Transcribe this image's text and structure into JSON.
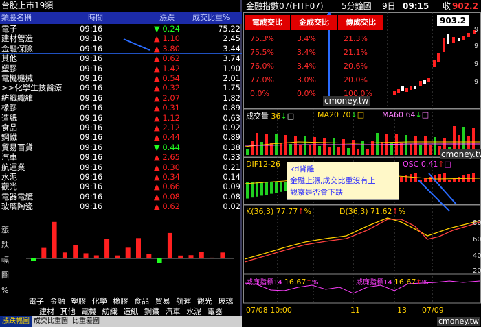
{
  "left_panel": {
    "title": "台股上市19類",
    "headers": [
      "類股名稱",
      "時間",
      "漲跌",
      "成交比重%"
    ],
    "rows": [
      {
        "name": "電子",
        "time": "09:16",
        "dir": "down",
        "chg": "0.24",
        "ratio": "75.22"
      },
      {
        "name": "建材營造",
        "time": "09:16",
        "dir": "up",
        "chg": "1.10",
        "ratio": "2.45"
      },
      {
        "name": "金融保險",
        "time": "09:16",
        "dir": "up",
        "chg": "3.80",
        "ratio": "3.44"
      },
      {
        "name": "其他",
        "time": "09:16",
        "dir": "up",
        "chg": "0.62",
        "ratio": "3.74"
      },
      {
        "name": "塑膠",
        "time": "09:16",
        "dir": "up",
        "chg": "1.42",
        "ratio": "1.90"
      },
      {
        "name": "電機機械",
        "time": "09:16",
        "dir": "up",
        "chg": "0.54",
        "ratio": "2.01"
      },
      {
        "name": ">>化學生技醫療",
        "time": "09:16",
        "dir": "up",
        "chg": "0.32",
        "ratio": "1.75"
      },
      {
        "name": "紡織纖維",
        "time": "09:16",
        "dir": "up",
        "chg": "2.07",
        "ratio": "1.82"
      },
      {
        "name": "橡膠",
        "time": "09:16",
        "dir": "up",
        "chg": "0.31",
        "ratio": "0.89"
      },
      {
        "name": "造紙",
        "time": "09:16",
        "dir": "up",
        "chg": "1.12",
        "ratio": "0.63"
      },
      {
        "name": "食品",
        "time": "09:16",
        "dir": "up",
        "chg": "2.12",
        "ratio": "0.92"
      },
      {
        "name": "鋼鐵",
        "time": "09:16",
        "dir": "up",
        "chg": "0.44",
        "ratio": "0.89"
      },
      {
        "name": "貿易百貨",
        "time": "09:16",
        "dir": "down",
        "chg": "0.44",
        "ratio": "0.38"
      },
      {
        "name": "汽車",
        "time": "09:16",
        "dir": "up",
        "chg": "2.65",
        "ratio": "0.33"
      },
      {
        "name": "航運業",
        "time": "09:16",
        "dir": "up",
        "chg": "0.30",
        "ratio": "0.21"
      },
      {
        "name": "水泥",
        "time": "09:16",
        "dir": "up",
        "chg": "0.34",
        "ratio": "0.14"
      },
      {
        "name": "觀光",
        "time": "09:16",
        "dir": "up",
        "chg": "0.66",
        "ratio": "0.09"
      },
      {
        "name": "電器電纜",
        "time": "09:16",
        "dir": "up",
        "chg": "0.08",
        "ratio": "0.08"
      },
      {
        "name": "玻璃陶瓷",
        "time": "09:16",
        "dir": "up",
        "chg": "0.62",
        "ratio": "0.02"
      }
    ],
    "bar_ylabel": "漲跌幅圖%",
    "bar_xlabels_row1": [
      "電子",
      "金融",
      "塑膠",
      "化學",
      "橡膠",
      "食品",
      "貿易",
      "航運",
      "觀光",
      "玻璃"
    ],
    "bar_xlabels_row2": [
      "建材",
      "其他",
      "電機",
      "紡織",
      "造紙",
      "鋼鐵",
      "汽車",
      "水泥",
      "電器"
    ],
    "tabs": [
      "漲跌幅圖",
      "成交比重圖",
      "比重差圖"
    ]
  },
  "right_panel": {
    "title": "金融指數07(FITF07)",
    "period": "5分鐘圖",
    "day": "9日",
    "time": "09:15",
    "close_label": "收",
    "close_value": "902.2",
    "price_tag": "903.2",
    "table_headers": [
      "電成交比",
      "金成交比",
      "傳成交比"
    ],
    "table_rows": [
      [
        "75.3%",
        "3.4%",
        "21.3%"
      ],
      [
        "75.5%",
        "3.4%",
        "21.1%"
      ],
      [
        "76.0%",
        "3.4%",
        "20.6%"
      ],
      [
        "77.0%",
        "3.0%",
        "20.0%"
      ],
      [
        "0.0%",
        "0.0%",
        "100.0%"
      ]
    ],
    "watermark": "cmoney.tw",
    "vol_label": "成交量",
    "vol_value": "36",
    "ma20_label": "MA20",
    "ma20_value": "70",
    "ma60_label": "MA60",
    "ma60_value": "64",
    "dif_label": "DIF12-26",
    "osc_label": "OSC",
    "osc_value": "0.41",
    "note_line1": "kd背離",
    "note_line2": "金融上漲,成交比重沒有上",
    "note_line3": "觀察是否會下跌",
    "k_label": "K(36,3)",
    "k_value": "77.77",
    "d_label": "D(36,3)",
    "d_value": "71.62",
    "will1_label": "威廉指標14",
    "will1_value": "16.67",
    "will2_label": "威廉指標14",
    "will2_value": "16.67",
    "xaxis": [
      "07/08 10:00",
      "11",
      "13",
      "07/09"
    ],
    "yaxis_k": [
      "80",
      "60",
      "40",
      "20"
    ],
    "yaxis_price": [
      "9",
      "9",
      "9",
      "9"
    ]
  },
  "chart_data": {
    "type": "bar",
    "title": "漲跌幅圖",
    "categories": [
      "電子",
      "建材",
      "金融",
      "其他",
      "塑膠",
      "電機",
      "化學",
      "紡織",
      "橡膠",
      "造紙",
      "食品",
      "鋼鐵",
      "貿易",
      "汽車",
      "航運",
      "水泥",
      "觀光",
      "電器",
      "玻璃"
    ],
    "values": [
      -0.24,
      1.1,
      3.8,
      0.62,
      1.42,
      0.54,
      0.32,
      2.07,
      0.31,
      1.12,
      2.12,
      0.44,
      -0.44,
      2.65,
      0.3,
      0.34,
      0.66,
      0.08,
      0.62
    ],
    "ylabel": "漲跌幅圖%"
  },
  "colors": {
    "up": "#ff2020",
    "down": "#20ff20",
    "header_bg": "#1c2ba8",
    "table_header": "#e00000",
    "note_bg": "#fff8c8"
  }
}
